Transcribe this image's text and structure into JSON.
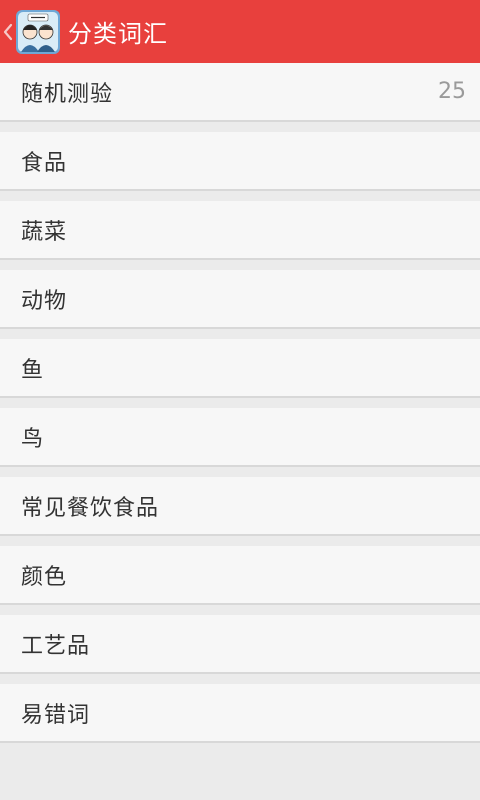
{
  "header": {
    "title": "分类词汇",
    "app_icon": "app-logo-icon",
    "back_icon": "chevron-left-icon",
    "bar_color": "#e8403d"
  },
  "categories": [
    {
      "label": "随机测验",
      "count": "25"
    },
    {
      "label": "食品"
    },
    {
      "label": "蔬菜"
    },
    {
      "label": "动物"
    },
    {
      "label": "鱼"
    },
    {
      "label": "鸟"
    },
    {
      "label": "常见餐饮食品"
    },
    {
      "label": "颜色"
    },
    {
      "label": "工艺品"
    },
    {
      "label": "易错词"
    }
  ]
}
